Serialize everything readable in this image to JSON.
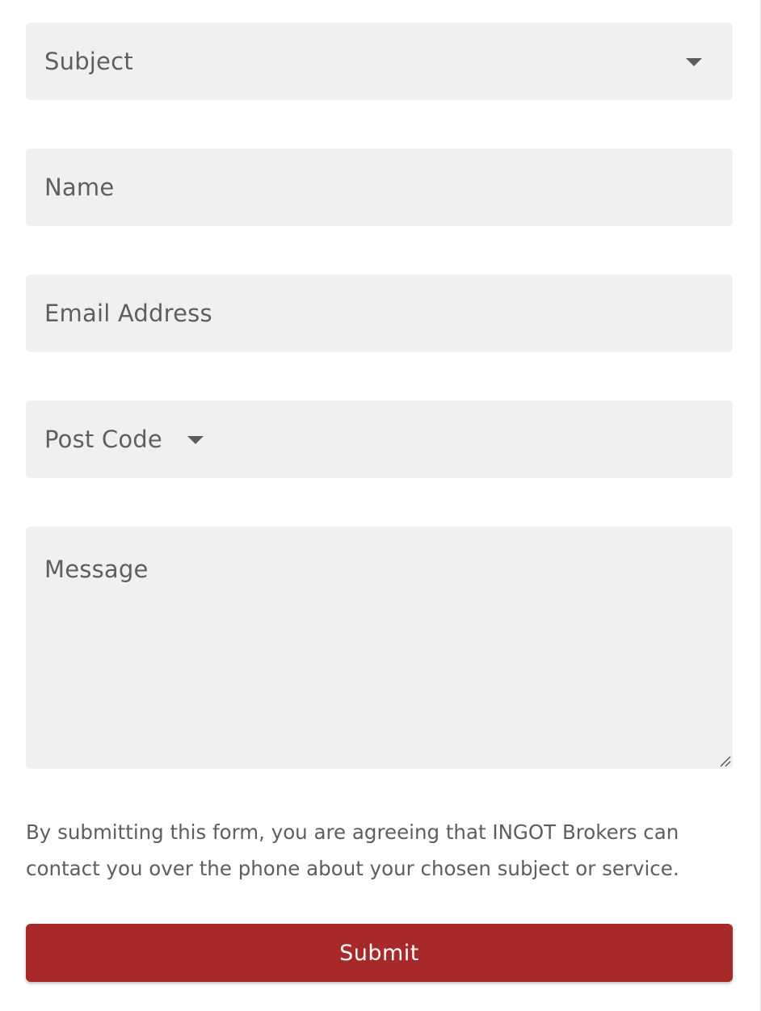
{
  "form": {
    "subject": {
      "placeholder": "Subject"
    },
    "name": {
      "placeholder": "Name"
    },
    "email": {
      "placeholder": "Email Address"
    },
    "post_code": {
      "placeholder": "Post Code"
    },
    "message": {
      "placeholder": "Message"
    },
    "consent_text": "By submitting this form, you are agreeing that INGOT Brokers can contact you over the phone about your chosen subject or service.",
    "submit_label": "Submit"
  },
  "colors": {
    "field_bg": "#f0f0f0",
    "submit_bg": "#a8292a",
    "text": "#5f5f5f"
  }
}
